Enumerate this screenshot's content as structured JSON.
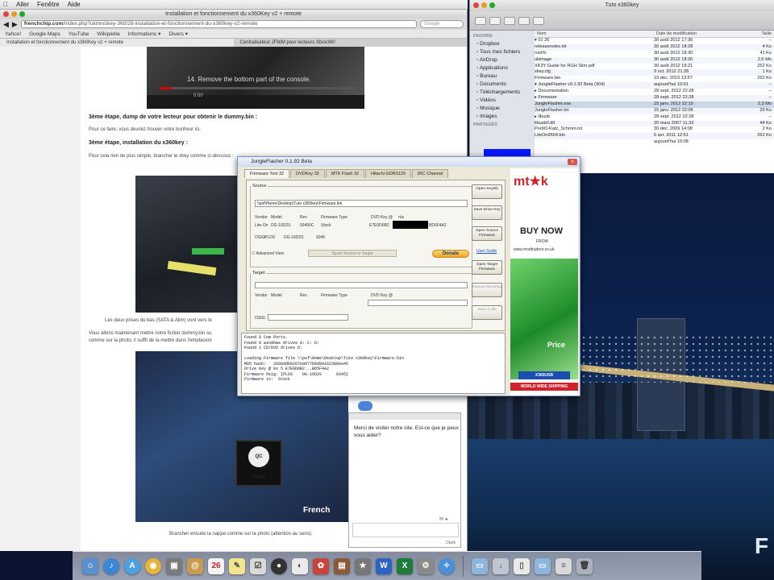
{
  "menubar": {
    "items": [
      "Aller",
      "Fenêtre",
      "Aide"
    ]
  },
  "browser": {
    "title": "Installation et fonctionnement du x360Key v2 + remote",
    "url_domain": "frenchchip.com",
    "url_rest": "/index.php?ukmn/ukey-360/28-installation-et-fonctionnement-du-x360key-v2-remote",
    "search_placeholder": "Google",
    "bookmarks": [
      "Yahoo!",
      "Google Maps",
      "YouTube",
      "Wikipédia",
      "Informations ▾",
      "Divers ▾"
    ],
    "tabs": [
      "Installation et fonctionnement du x360Key v2 + remote",
      "Centralisateur JFWM pour lecteurs Xbox360"
    ]
  },
  "article": {
    "video_caption": "14. Remove the bottom part of the console.",
    "video_time": "0:00",
    "h_step3": "3ème étape, dump de votre lecteur pour obtenir le dummy.bin :",
    "p_step3": "Pour ce faire, vous devriez trouver votre bonheur ici.",
    "h_install": "3ème étape, installation du x360key :",
    "p_install": "Pour cela rien de plus simple, brancher le xkey comme ci-dessous :",
    "p_photo1_caption": "Les deux prises du bas (SATA & Alim) vont vers le",
    "p_move1": "Vous allons maintenant mettre notre fichier dummy.bin su",
    "p_move2": "comme sur la photo, il suffit de la mettre dans l'emplacem",
    "qc_label": "QC PASS",
    "photo2_brand": "French",
    "p_bottom": "Brancher ensuite la nappe comme sur la photo (attention au sens)."
  },
  "finder": {
    "title": "Tuto x360key",
    "sidebar_heads": [
      "FAVORIS",
      "PARTAGÉS"
    ],
    "sidebar_items": [
      "Dropbox",
      "Tous mes fichiers",
      "AirDrop",
      "Applications",
      "Bureau",
      "Documents",
      "Téléchargements",
      "Vidéos",
      "Musique",
      "Images"
    ],
    "columns": [
      "Nom",
      "Date de modification",
      "Taille"
    ],
    "rows": [
      {
        "name": "▾ 01 26",
        "date": "30 août 2012 17:36",
        "size": "--"
      },
      {
        "name": "   releasenotes.txt",
        "date": "30 août 2012 18:28",
        "size": "4 Ko"
      },
      {
        "name": "   root%",
        "date": "30 août 2012 18:30",
        "size": "41 Ko"
      },
      {
        "name": "   ukimage",
        "date": "30 août 2012 18:30",
        "size": "2,6 Mo"
      },
      {
        "name": "   XK3Y Guide for RGH Slim.pdf",
        "date": "30 août 2012 19:21",
        "size": "252 Ko"
      },
      {
        "name": "   xkey.cfg",
        "date": "9 oct. 2012 21:28",
        "size": "1 Ko"
      },
      {
        "name": "   Firmware.bin",
        "date": "15 déc. 2010 13:57",
        "size": "262 Ko"
      },
      {
        "name": "▾ JungleFlasher v0.1.92 Beta (304)",
        "date": "aujourd'hui 10:01",
        "size": "--"
      },
      {
        "name": "   ▸ Documentation",
        "date": "28 sept. 2012 22:28",
        "size": "--"
      },
      {
        "name": "   ▸ Firmware",
        "date": "28 sept. 2012 22:28",
        "size": "--"
      },
      {
        "name": "   JungleFlasher.exe",
        "date": "15 janv. 2012 22:10",
        "size": "2,3 Mo"
      },
      {
        "name": "   JungleFlasher.txt",
        "date": "15 janv. 2012 22:06",
        "size": "20 Ko"
      },
      {
        "name": "   ▸ libusb",
        "date": "28 sept. 2012 22:28",
        "size": "--"
      },
      {
        "name": "   libusb0.dll",
        "date": "20 mars 2007 11:33",
        "size": "44 Ko"
      },
      {
        "name": "   PortIO-Katz_Schrom.txt",
        "date": "30 déc. 2009 14:08",
        "size": "2 Ko"
      },
      {
        "name": "   LiteOn9504.bin",
        "date": "6 avr. 2011 12:51",
        "size": "262 Ko"
      },
      {
        "name": "",
        "date": "aujourd'hui 10:08",
        "size": ""
      }
    ]
  },
  "jungleflasher": {
    "title": "JungleFlasher 0.1.92 Beta",
    "close": "x",
    "tabs": [
      "Firmware Tool 32",
      "DVDKey 32",
      "MTK Flash 32",
      "Hitachi GDR3120",
      "IRC Channel"
    ],
    "source_legend": "Source",
    "source_path": "\\\\psf\\Home\\Desktop\\Tuto x360key\\Firmware.bin",
    "col_vendor": "Vendor",
    "col_model": "Model",
    "col_rev": "Rev",
    "col_fwtype": "Firmware Type",
    "col_dvdkey": "DVD Key @",
    "val_na": "n/a",
    "val_vendor": "Lite-On",
    "val_model": "DG-16D2S",
    "val_rev": "93450C",
    "val_fwtype": "Stock",
    "val_key_prefix": "E7E0D6B2",
    "val_key_suffix": "BD5F4A2",
    "osig_label": "OSIG:",
    "osig_vendor": "PLDS",
    "osig_model": "DG-16D2S",
    "osig_rev": "9345",
    "adv_view": "Advanced View",
    "spoof_btn": "Spoof Source to Target",
    "donate": "Donate",
    "target_legend": "Target",
    "osig_label2": "OSIG:",
    "btn_open_keydb": "Open KeyDb",
    "btn_save_drive_key": "Save Drive Key",
    "btn_open_source_fw": "Open Source Firmware",
    "btn_user_guide": "User Guide",
    "btn_open_target_fw": "Open Target Firmware",
    "btn_manual_spoofing": "Manual Spoofing",
    "btn_save_to_file": "Save to file",
    "log": "Found 0 Com Ports.\nFound 0 windows drives A: C: D:\nFound 1 CD/DVD drives D:\n\nLoading Firmware file \\\\psf\\Home\\Desktop\\Tuto x360key\\Firmware.bin\nMD5 hash:   2660ddb8267e0077b8d99162380ea45\nDrive Key @ 0x 5 E7E0D6B2...BD5F4A2\nFirmware Osig: [PLDS    DG-16D2S      9345]\nFirmware is:  Stock",
    "ad_logo": "mt★k",
    "ad_buy": "BUY NOW",
    "ad_from": "FROM",
    "ad_site": "www.modtraders.co.uk",
    "ad_price": "Price",
    "ad_x360": "X360USB",
    "ad_ship": "WORLD WIDE SHIPPING"
  },
  "chat": {
    "message": "Merci de visiter notre site. Est-ce que je peux vous aider?",
    "footer": "Olark"
  },
  "colors": {
    "accent_blue": "#0a16ff",
    "finder_selection": "#cbd6e6",
    "donate": "#f0a620"
  }
}
